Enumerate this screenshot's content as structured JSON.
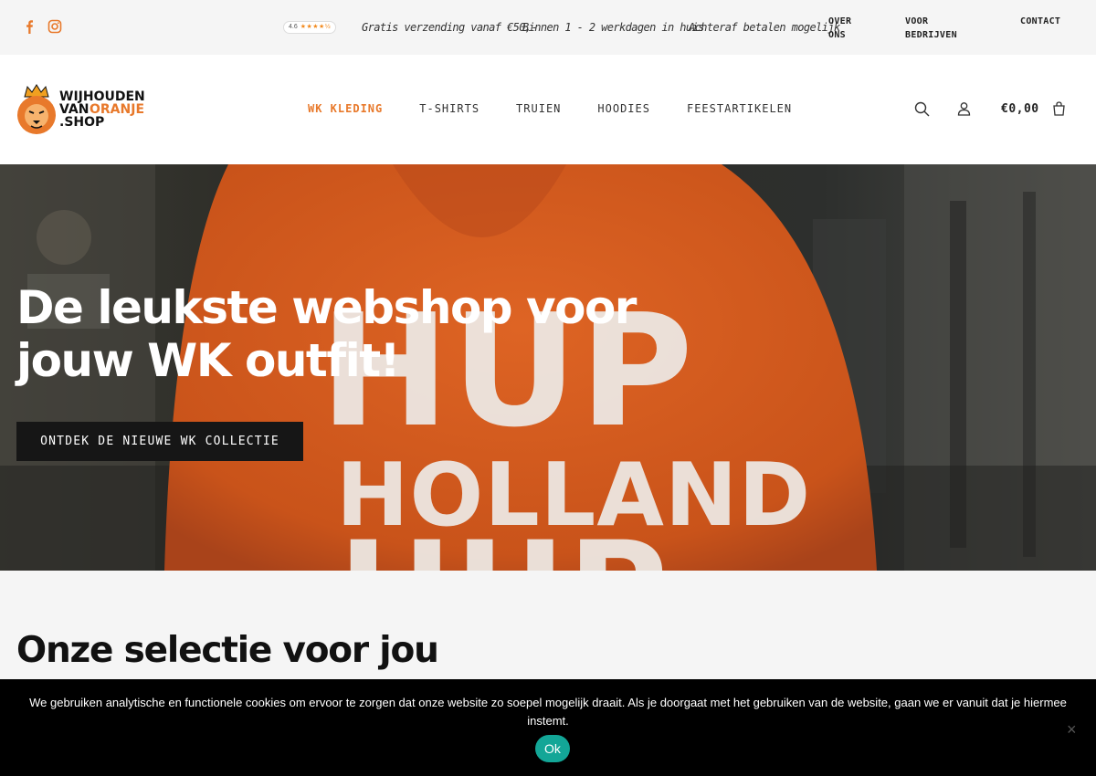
{
  "topbar": {
    "rating": {
      "score": "4.6",
      "stars": "★★★★½"
    },
    "usps": [
      "Gratis verzending vanaf €50,-",
      "Binnen 1 - 2 werkdagen in huis",
      "Achteraf betalen mogelijk"
    ],
    "links": [
      "OVER\nONS",
      "VOOR\nBEDRIJVEN",
      "CONTACT"
    ],
    "social": [
      "facebook-icon",
      "instagram-icon"
    ]
  },
  "header": {
    "logo": {
      "line1": "WIJHOUDEN",
      "line2a": "VAN",
      "line2b": "ORANJE",
      "line3": ".SHOP"
    },
    "nav": [
      "WK KLEDING",
      "T-SHIRTS",
      "TRUIEN",
      "HOODIES",
      "FEESTARTIKELEN"
    ],
    "active_nav": "WK KLEDING",
    "cart_total": "€0,00",
    "icons": [
      "search-icon",
      "account-icon",
      "cart-icon"
    ]
  },
  "hero": {
    "title": "De leukste webshop voor jouw WK outfit!",
    "button": "ONTDEK DE NIEUWE WK COLLECTIE",
    "print_lines": [
      "HUP",
      "HOLLAND",
      "HUP"
    ]
  },
  "section": {
    "title": "Onze selectie voor jou"
  },
  "cookie": {
    "text": "We gebruiken analytische en functionele cookies om ervoor te zorgen dat onze website zo soepel mogelijk draait. Als je doorgaat met het gebruiken van de website, gaan we er vanuit dat je hiermee instemt.",
    "ok": "Ok",
    "close": "×"
  },
  "colors": {
    "accent": "#e8792b",
    "hoodie": "#d45a1c",
    "cookie_button": "#13a697"
  }
}
